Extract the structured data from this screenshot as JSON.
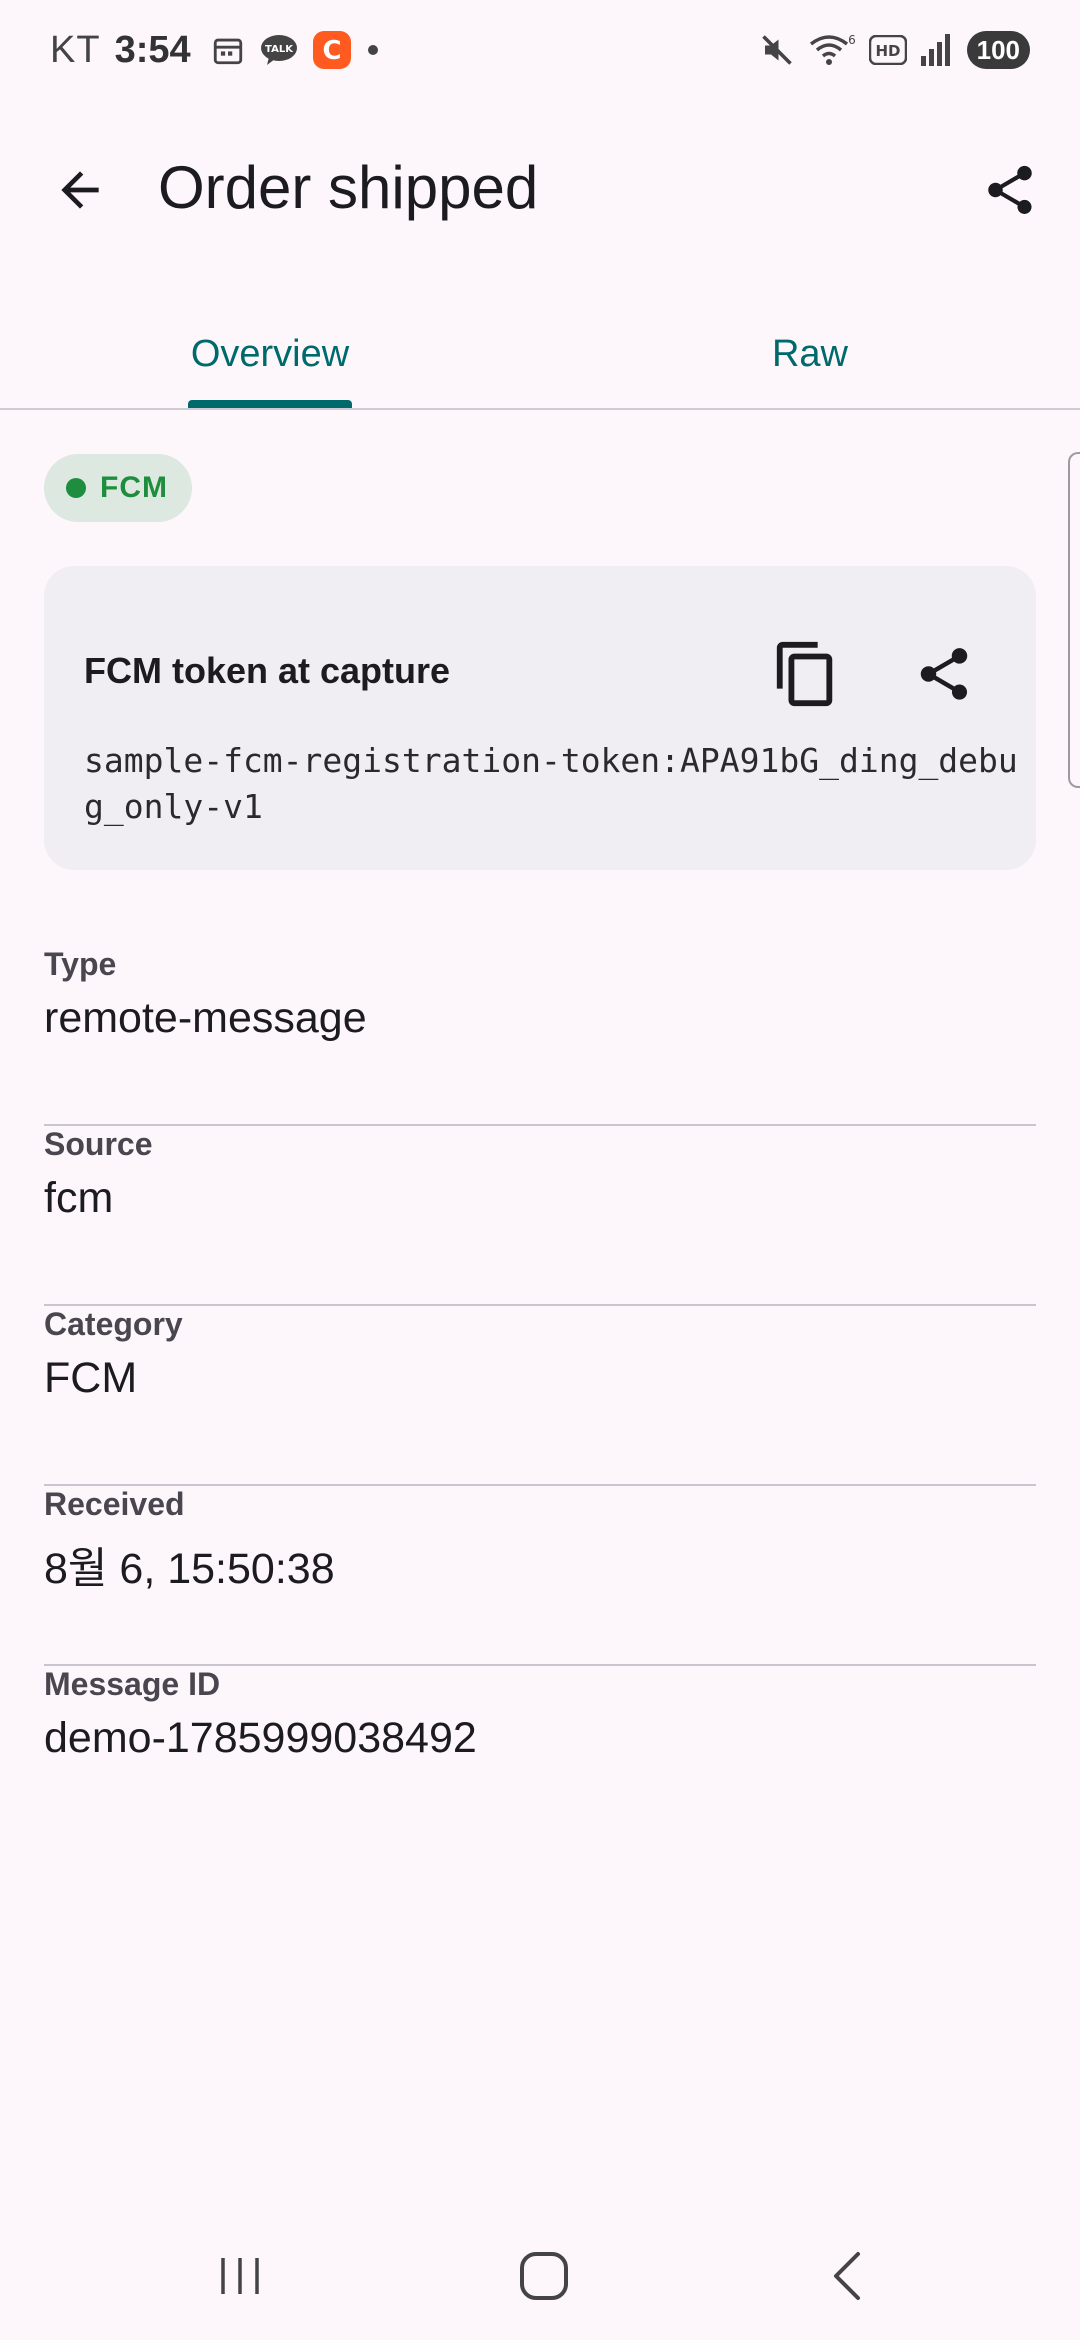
{
  "status_bar": {
    "carrier": "KT",
    "time": "3:54",
    "talk_label": "TALK",
    "app_badge": "C",
    "battery": "100",
    "icons": [
      "calendar-icon",
      "kakaotalk-icon",
      "app-c-icon",
      "dot-icon",
      "mute-icon",
      "wifi-icon",
      "hd-icon",
      "signal-icon",
      "battery-icon"
    ]
  },
  "app_bar": {
    "title": "Order shipped",
    "back_icon": "arrow-back-icon",
    "share_icon": "share-icon"
  },
  "tabs": [
    {
      "label": "Overview",
      "selected": true
    },
    {
      "label": "Raw",
      "selected": false
    }
  ],
  "chip": {
    "label": "FCM",
    "color": "#1E8E3E"
  },
  "token_card": {
    "title": "FCM token at capture",
    "value": "sample-fcm-registration-token:APA91bG_ding_debug_only-v1",
    "copy_icon": "copy-icon",
    "share_icon": "share-icon"
  },
  "fields": [
    {
      "label": "Type",
      "value": "remote-message"
    },
    {
      "label": "Source",
      "value": "fcm"
    },
    {
      "label": "Category",
      "value": "FCM"
    },
    {
      "label": "Received",
      "value": "8월 6, 15:50:38"
    },
    {
      "label": "Message ID",
      "value": "demo-1785999038492"
    }
  ],
  "colors": {
    "accent": "#00696B",
    "background": "#FDF7FC",
    "card": "#F1EEF3",
    "chip_bg": "#DDE8E1"
  }
}
